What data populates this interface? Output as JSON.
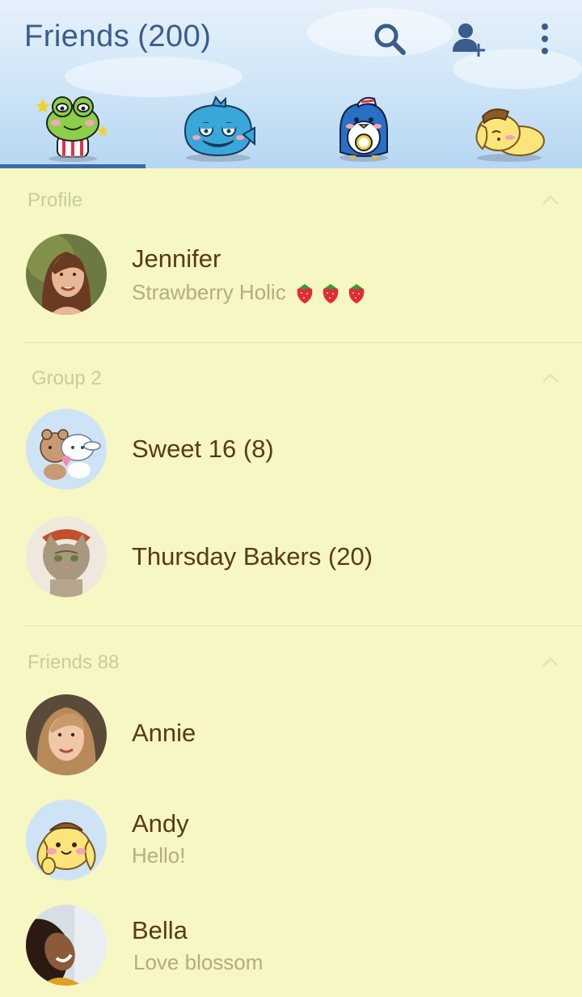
{
  "header": {
    "title": "Friends",
    "count": "(200)",
    "search_icon": "search-icon",
    "add_friend_icon": "add-friend-icon",
    "more_icon": "more-vertical-icon",
    "accent_color": "#3a5c8f"
  },
  "tabs": [
    {
      "name": "frog-character-tab",
      "selected": true
    },
    {
      "name": "fish-character-tab",
      "selected": false
    },
    {
      "name": "penguin-character-tab",
      "selected": false
    },
    {
      "name": "puppy-character-tab",
      "selected": false
    }
  ],
  "sections": {
    "profile": {
      "title": "Profile"
    },
    "groups": {
      "title": "Group 2"
    },
    "friends": {
      "title": "Friends 88"
    }
  },
  "profile": {
    "name": "Jennifer",
    "status": "Strawberry Holic"
  },
  "groups": [
    {
      "name": "Sweet 16 (8)"
    },
    {
      "name": "Thursday Bakers (20)"
    }
  ],
  "friends": [
    {
      "name": "Annie",
      "status": ""
    },
    {
      "name": "Andy",
      "status": "Hello!"
    },
    {
      "name": "Bella",
      "status": "Love blossom"
    }
  ]
}
